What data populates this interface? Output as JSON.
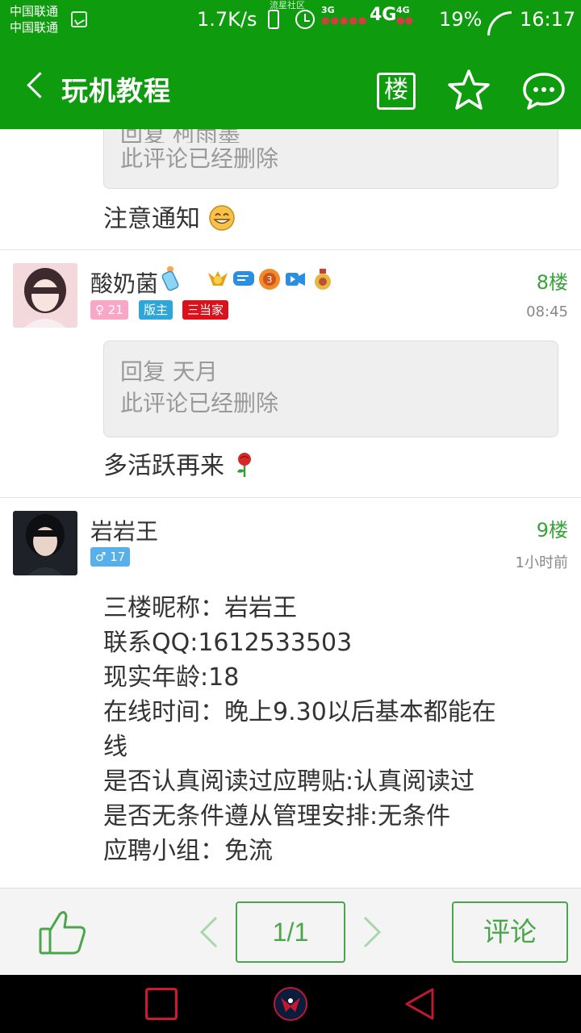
{
  "status_bar": {
    "carrier_1": "中国联通",
    "carrier_2": "中国联通",
    "net_speed": "1.7K/s",
    "community_tag": "流星社区",
    "net_3g": "3G",
    "net_4g": "4G",
    "net_4g_small": "4G",
    "battery": "19%",
    "time": "16:17"
  },
  "app_bar": {
    "title": "玩机教程",
    "floor_button": "楼",
    "color": "#0e9b0e"
  },
  "posts": [
    {
      "quote_prefix_partial": "回复 柯雨墨",
      "quote_text": "此评论已经删除",
      "reply": "注意通知"
    },
    {
      "username": "酸奶菌",
      "floor": "8楼",
      "time": "08:45",
      "badges": [
        "♀ 21",
        "版主",
        "三当家"
      ],
      "medal_number": "3",
      "quote_prefix": "回复 天月",
      "quote_text": "此评论已经删除",
      "reply": "多活跃再来"
    },
    {
      "username": "岩岩王",
      "floor": "9楼",
      "time": "1小时前",
      "badges": [
        "♂ 17"
      ],
      "body_lines": [
        "三楼昵称：岩岩王",
        "联系QQ:1612533503",
        "现实年龄:18",
        "在线时间：晚上9.30以后基本都能在",
        "线",
        "是否认真阅读过应聘贴:认真阅读过",
        "是否无条件遵从管理安排:无条件",
        "应聘小组：免流"
      ]
    }
  ],
  "bottom_bar": {
    "page_indicator": "1/1",
    "comment_label": "评论"
  },
  "icons": {
    "back": "back-arrow-icon",
    "star": "star-icon",
    "chat": "chat-bubble-icon",
    "like": "thumbs-up-icon",
    "prev": "chevron-left-icon",
    "next": "chevron-right-icon"
  },
  "colors": {
    "accent": "#0e9b0e",
    "floor_text": "#3aa23a",
    "button_border": "#4aa64a",
    "badge_female": "#f9a7c6",
    "badge_male": "#57b0ea",
    "badge_mod": "#2fa6d8",
    "badge_third": "#d9121c"
  }
}
